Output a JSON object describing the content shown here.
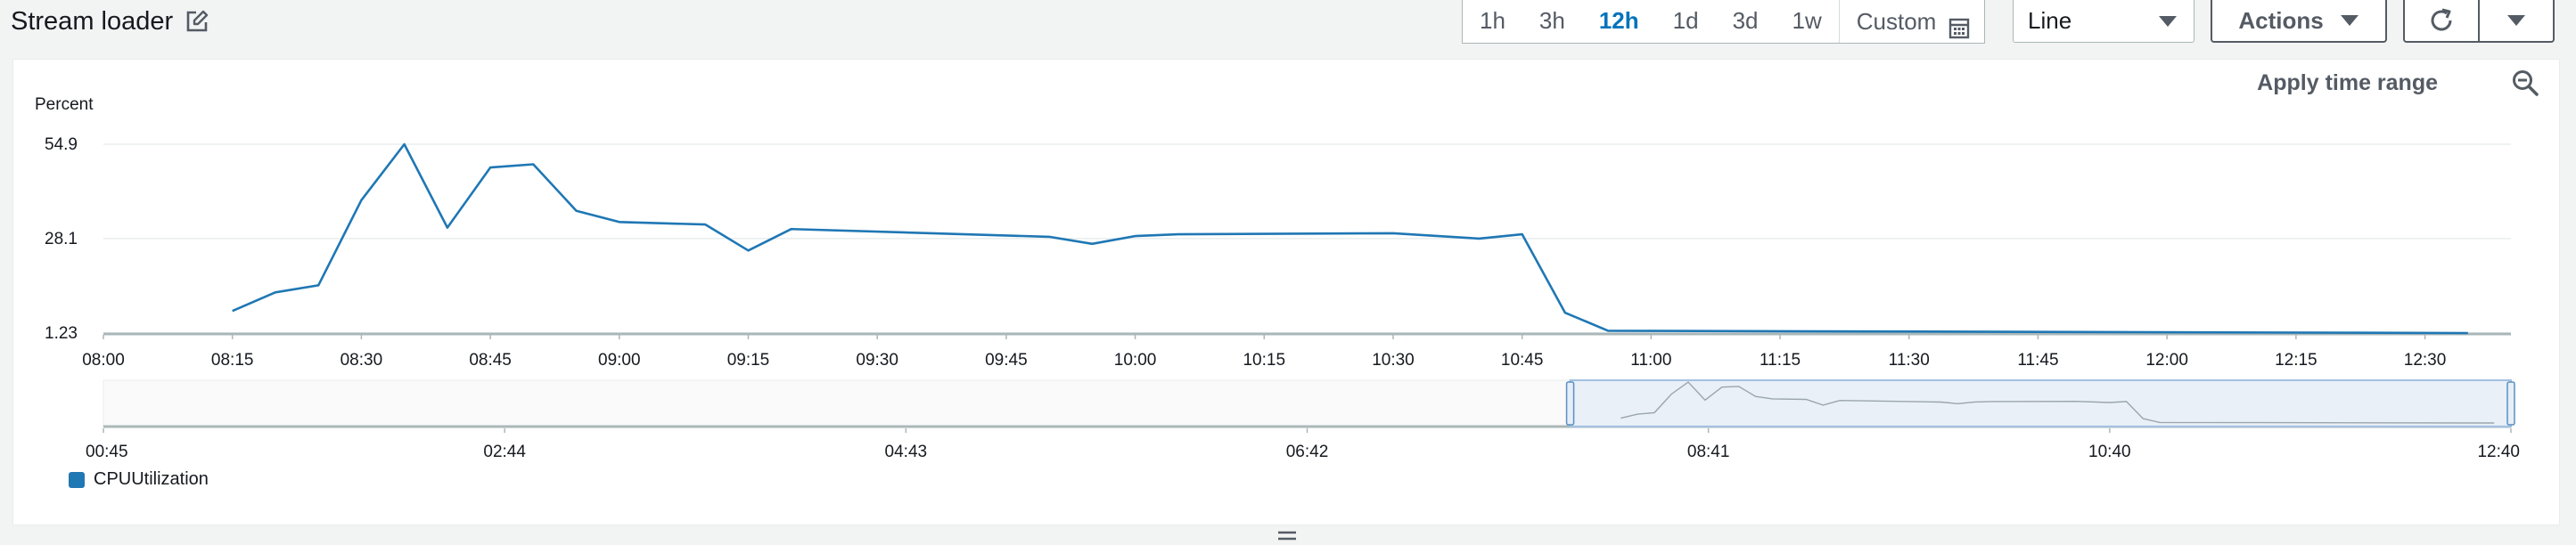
{
  "header": {
    "title": "Stream loader",
    "time_ranges": [
      "1h",
      "3h",
      "12h",
      "1d",
      "3d",
      "1w"
    ],
    "active_time_range": "12h",
    "custom_label": "Custom",
    "view_select": "Line",
    "actions_label": "Actions"
  },
  "widget": {
    "apply_time_range_label": "Apply time range"
  },
  "colors": {
    "series": "#1f77b4",
    "active": "#0073bb"
  },
  "chart_data": {
    "type": "line",
    "ylabel": "Percent",
    "yticks": [
      "54.9",
      "28.1",
      "1.23"
    ],
    "ylim": [
      1.23,
      54.9
    ],
    "xticks": [
      "08:00",
      "08:15",
      "08:30",
      "08:45",
      "09:00",
      "09:15",
      "09:30",
      "09:45",
      "10:00",
      "10:15",
      "10:30",
      "10:45",
      "11:00",
      "11:15",
      "11:30",
      "11:45",
      "12:00",
      "12:15",
      "12:30"
    ],
    "xrange": [
      "08:00",
      "12:40"
    ],
    "series": [
      {
        "name": "CPUUtilization",
        "x": [
          "08:15",
          "08:20",
          "08:25",
          "08:30",
          "08:35",
          "08:40",
          "08:45",
          "08:50",
          "08:55",
          "09:00",
          "09:10",
          "09:15",
          "09:20",
          "09:50",
          "09:55",
          "10:00",
          "10:05",
          "10:30",
          "10:40",
          "10:45",
          "10:50",
          "10:55",
          "12:35"
        ],
        "y": [
          7.5,
          12.8,
          14.8,
          39.0,
          54.9,
          31.2,
          48.3,
          49.2,
          36.0,
          32.8,
          32.1,
          24.7,
          30.8,
          28.6,
          26.6,
          28.8,
          29.3,
          29.6,
          28.1,
          29.3,
          7.0,
          1.9,
          1.23
        ]
      }
    ],
    "grid": true,
    "navigator": {
      "ticks": [
        "00:45",
        "02:44",
        "04:43",
        "06:42",
        "08:41",
        "10:40",
        "12:40"
      ],
      "selected_range": [
        "08:00",
        "12:40"
      ]
    },
    "legend": "bottom-left"
  }
}
